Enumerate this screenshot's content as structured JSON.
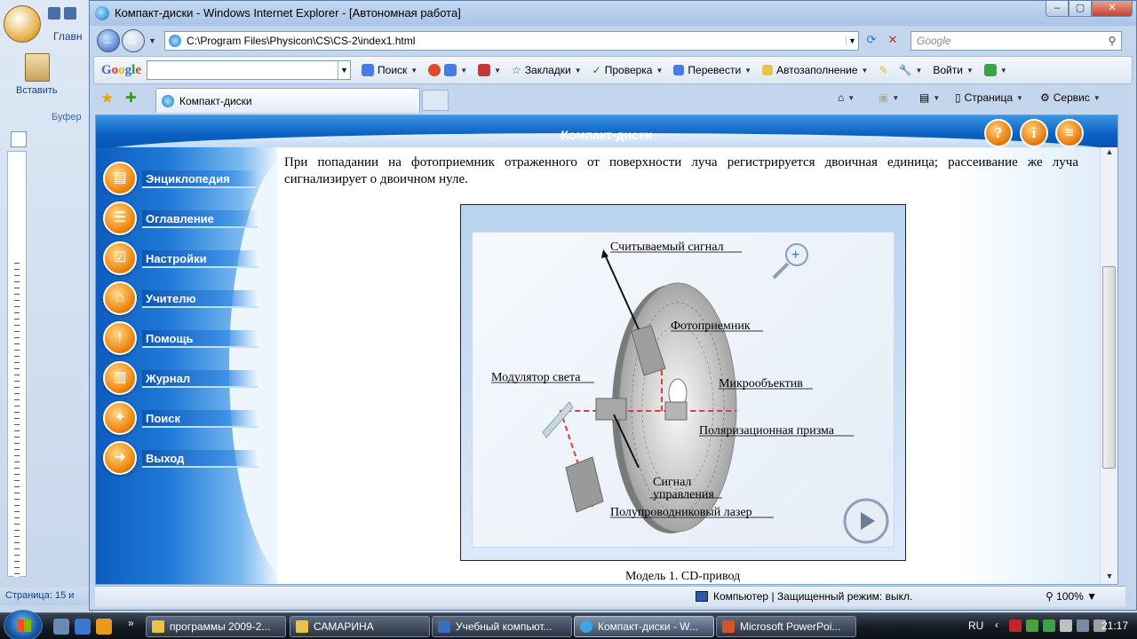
{
  "word": {
    "tab_label": "Главн",
    "paste_label": "Вставить",
    "group_label": "Буфер",
    "status_label": "Страница: 15 и"
  },
  "ie": {
    "title": "Компакт-диски - Windows Internet Explorer - [Автономная работа]",
    "address": "C:\\Program Files\\Physicon\\CS\\CS-2\\index1.html",
    "search_placeholder": "Google",
    "tab_title": "Компакт-диски",
    "google_toolbar": {
      "search_btn": "Поиск",
      "bookmarks": "Закладки",
      "check": "Проверка",
      "translate": "Перевести",
      "autofill": "Автозаполнение",
      "signin": "Войти"
    },
    "commands": {
      "page": "Страница",
      "service": "Сервис"
    },
    "status": {
      "zone": "Компьютер | Защищенный режим: выкл.",
      "zoom": "100%"
    }
  },
  "app": {
    "title": "Компакт-диски",
    "header_buttons": [
      "?",
      "i",
      "≡"
    ],
    "menu": [
      {
        "label": "Энциклопедия",
        "icon": "book-icon",
        "glyph": "▤"
      },
      {
        "label": "Оглавление",
        "icon": "list-icon",
        "glyph": "☰"
      },
      {
        "label": "Настройки",
        "icon": "checkbox-icon",
        "glyph": "☑"
      },
      {
        "label": "Учителю",
        "icon": "graduation-cap-icon",
        "glyph": "⌂"
      },
      {
        "label": "Помощь",
        "icon": "help-book-icon",
        "glyph": "!"
      },
      {
        "label": "Журнал",
        "icon": "journal-icon",
        "glyph": "▥"
      },
      {
        "label": "Поиск",
        "icon": "search-icon",
        "glyph": "✦"
      },
      {
        "label": "Выход",
        "icon": "exit-icon",
        "glyph": "➜"
      }
    ],
    "paragraph": "При попадании на фотоприемник отраженного от поверхности луча регистрируется двоичная единица; рассеивание же луча сигнализирует о двоичном нуле.",
    "figure_labels": {
      "signal_read": "Считываемый сигнал",
      "photodetector": "Фотоприемник",
      "modulator": "Модулятор света",
      "microlens": "Микрообъектив",
      "prism": "Поляризационная призма",
      "control_signal_1": "Сигнал",
      "control_signal_2": "управления",
      "laser": "Полупроводниковый лазер"
    },
    "caption": "Модель 1. CD-привод"
  },
  "taskbar": {
    "tasks": [
      {
        "label": "программы 2009-2...",
        "color": "#e8c34a"
      },
      {
        "label": "САМАРИНА",
        "color": "#e8c34a"
      },
      {
        "label": "Учебный компьют...",
        "color": "#3a6fc0"
      },
      {
        "label": "Компакт-диски - W...",
        "color": "#3aa6e6"
      },
      {
        "label": "Microsoft PowerPoi...",
        "color": "#d2552a"
      }
    ],
    "lang": "RU",
    "clock": "21:17"
  },
  "colors": {
    "accent": "#0b61c4",
    "orange": "#ef8a14",
    "laser": "#e23a3a"
  }
}
